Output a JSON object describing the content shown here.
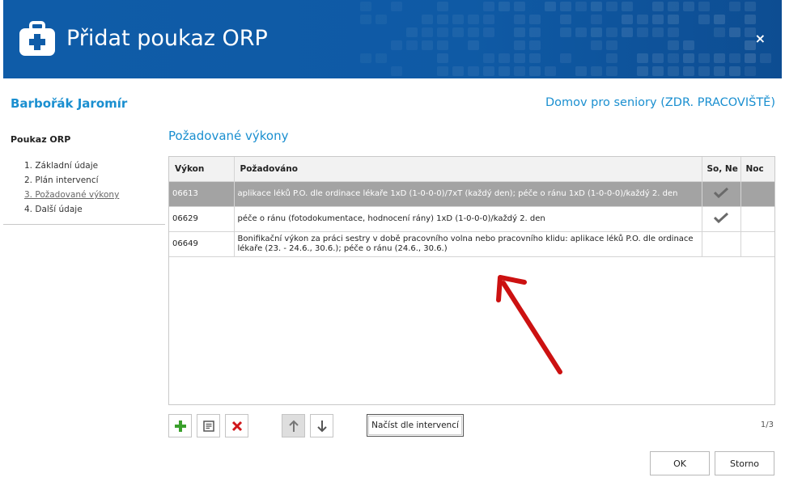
{
  "dialog": {
    "title": "Přidat poukaz ORP",
    "close_label": "×"
  },
  "patient": {
    "name": "Barbořák Jaromír",
    "facility": "Domov pro seniory (ZDR. PRACOVIŠTĚ)"
  },
  "sidebar": {
    "title": "Poukaz ORP",
    "items": [
      {
        "label": "1. Základní údaje",
        "active": false
      },
      {
        "label": "2. Plán intervencí",
        "active": false
      },
      {
        "label": "3. Požadované výkony",
        "active": true
      },
      {
        "label": "4. Další údaje",
        "active": false
      }
    ]
  },
  "main": {
    "section_title": "Požadované výkony",
    "table": {
      "columns": [
        "Výkon",
        "Požadováno",
        "So, Ne",
        "Noc"
      ],
      "rows": [
        {
          "code": "06613",
          "description": "aplikace léků P.O. dle ordinace lékaře 1xD (1-0-0-0)/7xT (každý den); péče o ránu 1xD (1-0-0-0)/každý 2. den",
          "weekend": true,
          "night": false,
          "selected": true
        },
        {
          "code": "06629",
          "description": "péče o ránu (fotodokumentace, hodnocení rány) 1xD (1-0-0-0)/každý 2. den",
          "weekend": true,
          "night": false,
          "selected": false
        },
        {
          "code": "06649",
          "description": "Bonifikační výkon za práci sestry v době pracovního volna nebo pracovního klidu: aplikace léků P.O. dle ordinace lékaře (23. - 24.6., 30.6.); péče o ránu (24.6., 30.6.)",
          "weekend": false,
          "night": false,
          "selected": false
        }
      ]
    },
    "toolbar": {
      "add_icon": "plus-icon",
      "edit_icon": "edit-icon",
      "delete_icon": "delete-icon",
      "move_up_icon": "arrow-up-icon",
      "move_down_icon": "arrow-down-icon",
      "load_label": "Načíst dle intervencí"
    },
    "pager": "1/3"
  },
  "footer": {
    "ok_label": "OK",
    "cancel_label": "Storno"
  },
  "colors": {
    "header_blue": "#0f5ca8",
    "accent_blue": "#1a8fd0",
    "selected_row": "#a3a3a3",
    "annotation_red": "#cc1111"
  }
}
